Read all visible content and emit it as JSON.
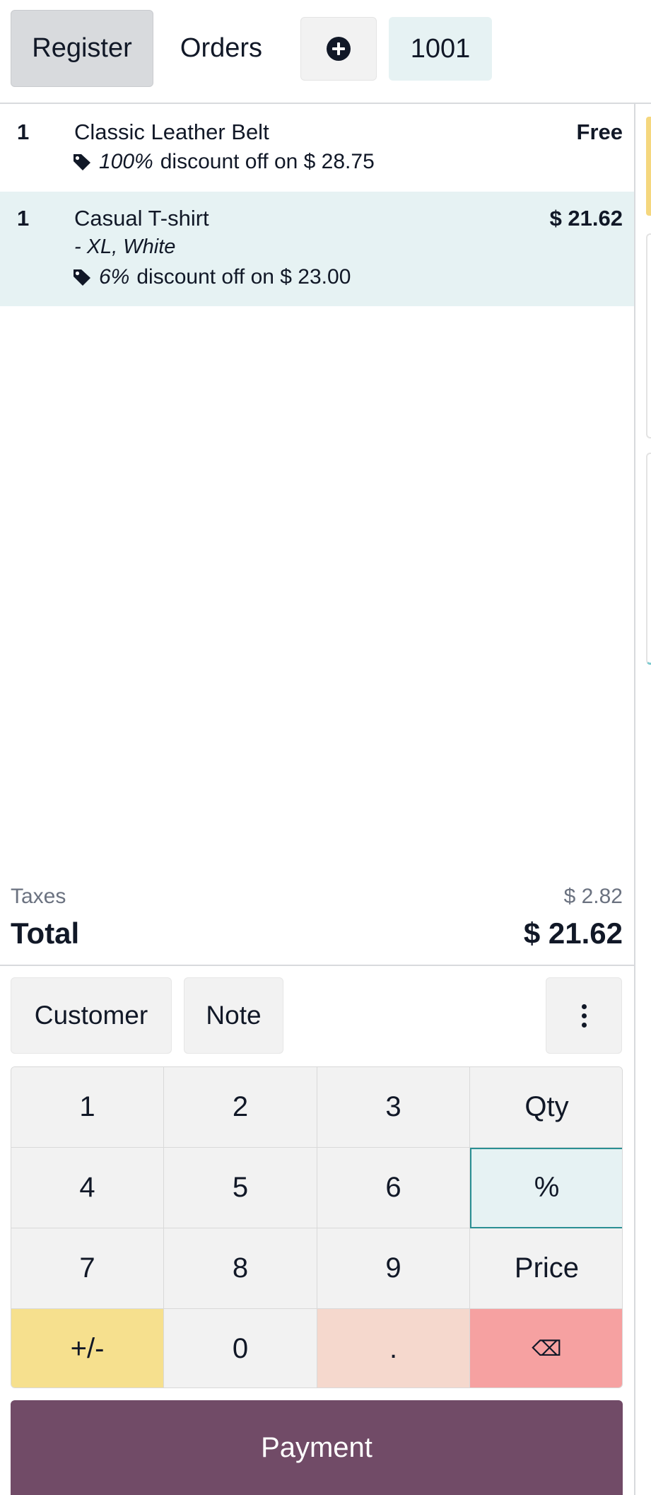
{
  "topbar": {
    "register_label": "Register",
    "orders_label": "Orders",
    "add_icon": "plus-circle-icon",
    "order_number": "1001"
  },
  "order_lines": [
    {
      "qty": "1",
      "name": "Classic Leather Belt",
      "price": "Free",
      "variant": "",
      "discount_pct": "100%",
      "discount_text": "discount off on $ 28.75"
    },
    {
      "qty": "1",
      "name": "Casual T-shirt",
      "price": "$ 21.62",
      "variant": "- XL, White",
      "discount_pct": "6%",
      "discount_text": "discount off on $ 23.00"
    }
  ],
  "totals": {
    "taxes_label": "Taxes",
    "taxes_value": "$ 2.82",
    "total_label": "Total",
    "total_value": "$ 21.62"
  },
  "controls": {
    "customer_label": "Customer",
    "note_label": "Note",
    "more_icon": "vertical-ellipsis-icon"
  },
  "numpad": {
    "keys": [
      "1",
      "2",
      "3",
      "Qty",
      "4",
      "5",
      "6",
      "%",
      "7",
      "8",
      "9",
      "Price",
      "+/-",
      "0",
      ".",
      "⌫"
    ],
    "selected_mode": "%"
  },
  "payment_label": "Payment",
  "colors": {
    "accent": "#714b67",
    "selected_line": "#e6f2f3",
    "sign_key": "#f6e08e",
    "dot_key": "#f5d8cd",
    "backspace_key": "#f6a1a1"
  }
}
